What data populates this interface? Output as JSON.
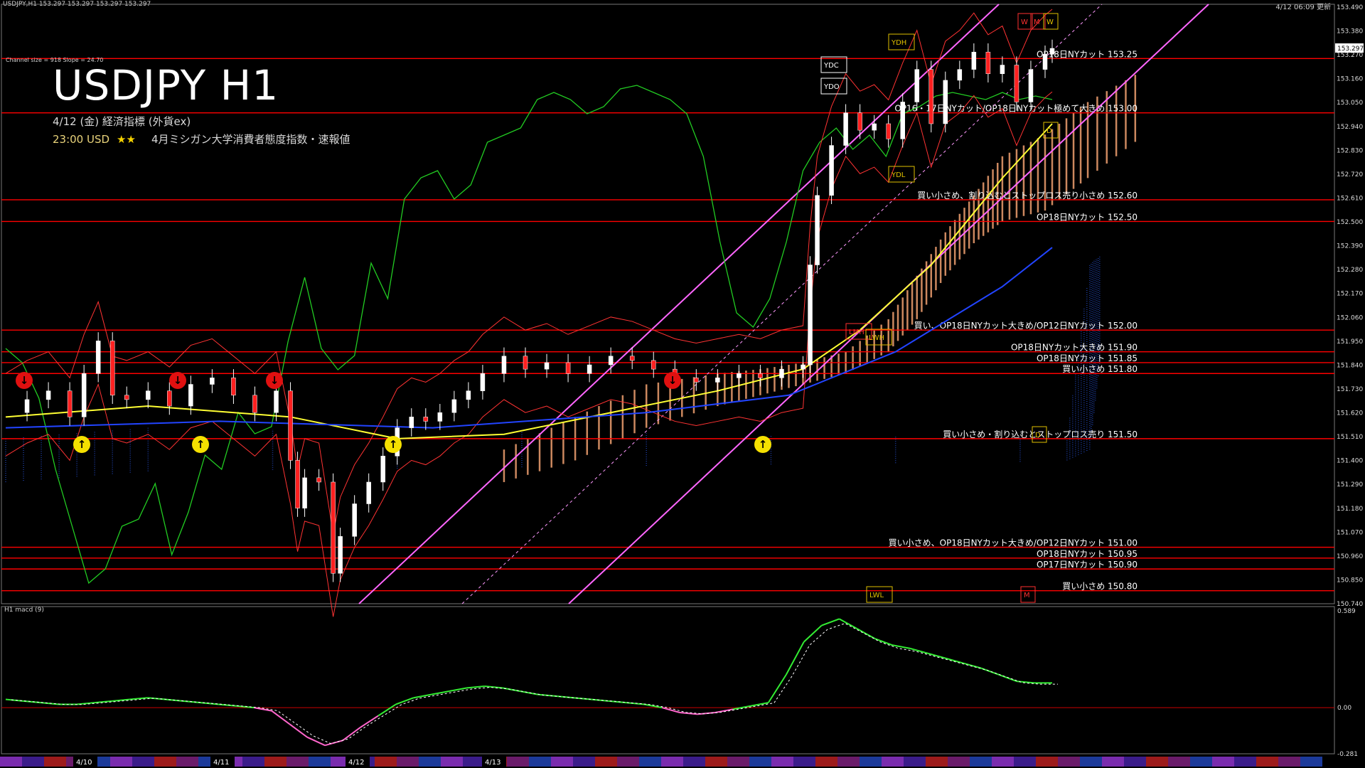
{
  "window": {
    "title": "USDJPY,H1  153.297 153.297 153.297 153.297",
    "timestamp": "4/12 06:09 更新"
  },
  "chart_title": "USDJPY H1",
  "channel_info": "Channel size = 918 Slope = 24.70",
  "event": {
    "heading": "4/12 (金) 経済指標 (外貨ex)",
    "time": "23:00 USD",
    "stars": "★★",
    "description": "4月ミシガン大学消費者態度指数・速報値"
  },
  "colors": {
    "background": "#000000",
    "level_line": "#ff0000",
    "channel": "#ff66ff",
    "ma_fast": "#ffff33",
    "ma_slow": "#2244ff",
    "bb": "#ff3333",
    "rsi": "#22cc22",
    "cloud": "#f0a070",
    "macd_pos": "#33ee33",
    "macd_neg": "#ff66cc"
  },
  "chart_data": [
    {
      "type": "line",
      "title": "USDJPY H1",
      "ylim": [
        150.74,
        153.5
      ],
      "y_ticks": [
        "153.490",
        "153.380",
        "153.270",
        "153.160",
        "153.050",
        "152.940",
        "152.830",
        "152.720",
        "152.610",
        "152.500",
        "152.390",
        "152.280",
        "152.170",
        "152.060",
        "151.950",
        "151.840",
        "151.730",
        "151.620",
        "151.510",
        "151.400",
        "151.290",
        "151.180",
        "151.070",
        "150.960",
        "150.850",
        "150.740"
      ],
      "current_price": "153.297",
      "date_labels": [
        "4/10",
        "4/11",
        "4/12",
        "4/13"
      ],
      "levels": [
        {
          "y": 153.25,
          "label": "OP18日NYカット 153.25"
        },
        {
          "y": 153.0,
          "label": "OP16・17日NYカット/OP18日NYカット極めて大きめ 153.00"
        },
        {
          "y": 152.6,
          "label": "買い小さめ、割り込むとストップロス売り小さめ 152.60"
        },
        {
          "y": 152.5,
          "label": "OP18日NYカット 152.50"
        },
        {
          "y": 152.0,
          "label": "買い、OP18日NYカット大きめ/OP12日NYカット 152.00"
        },
        {
          "y": 151.9,
          "label": "OP18日NYカット大きめ 151.90"
        },
        {
          "y": 151.85,
          "label": "OP18日NYカット 151.85"
        },
        {
          "y": 151.8,
          "label": "買い小さめ 151.80"
        },
        {
          "y": 151.5,
          "label": "買い小さめ・割り込むとストップロス売り 151.50"
        },
        {
          "y": 151.0,
          "label": "買い小さめ、OP18日NYカット大きめ/OP12日NYカット 151.00"
        },
        {
          "y": 150.95,
          "label": "OP18日NYカット 150.95"
        },
        {
          "y": 150.9,
          "label": "OP17日NYカット 150.90"
        },
        {
          "y": 150.8,
          "label": "買い小さめ 150.80"
        }
      ],
      "markers": [
        "YDH",
        "YDC",
        "YDO",
        "YDL",
        "LMH",
        "LWH",
        "LWL",
        "W",
        "M",
        "W",
        "D",
        "D",
        "M"
      ],
      "price_series": [
        {
          "t": 0,
          "v": 151.62
        },
        {
          "t": 3,
          "v": 151.68
        },
        {
          "t": 6,
          "v": 151.72
        },
        {
          "t": 9,
          "v": 151.6
        },
        {
          "t": 11,
          "v": 151.8
        },
        {
          "t": 13,
          "v": 151.95
        },
        {
          "t": 15,
          "v": 151.7
        },
        {
          "t": 17,
          "v": 151.68
        },
        {
          "t": 20,
          "v": 151.72
        },
        {
          "t": 23,
          "v": 151.65
        },
        {
          "t": 26,
          "v": 151.75
        },
        {
          "t": 29,
          "v": 151.78
        },
        {
          "t": 32,
          "v": 151.7
        },
        {
          "t": 35,
          "v": 151.62
        },
        {
          "t": 38,
          "v": 151.72
        },
        {
          "t": 40,
          "v": 151.4
        },
        {
          "t": 41,
          "v": 151.18
        },
        {
          "t": 42,
          "v": 151.32
        },
        {
          "t": 44,
          "v": 151.3
        },
        {
          "t": 46,
          "v": 150.88
        },
        {
          "t": 47,
          "v": 151.05
        },
        {
          "t": 49,
          "v": 151.2
        },
        {
          "t": 51,
          "v": 151.3
        },
        {
          "t": 53,
          "v": 151.42
        },
        {
          "t": 55,
          "v": 151.55
        },
        {
          "t": 57,
          "v": 151.6
        },
        {
          "t": 59,
          "v": 151.58
        },
        {
          "t": 61,
          "v": 151.62
        },
        {
          "t": 63,
          "v": 151.68
        },
        {
          "t": 65,
          "v": 151.72
        },
        {
          "t": 67,
          "v": 151.8
        },
        {
          "t": 70,
          "v": 151.88
        },
        {
          "t": 73,
          "v": 151.82
        },
        {
          "t": 76,
          "v": 151.85
        },
        {
          "t": 79,
          "v": 151.8
        },
        {
          "t": 82,
          "v": 151.84
        },
        {
          "t": 85,
          "v": 151.88
        },
        {
          "t": 88,
          "v": 151.86
        },
        {
          "t": 91,
          "v": 151.82
        },
        {
          "t": 94,
          "v": 151.78
        },
        {
          "t": 97,
          "v": 151.76
        },
        {
          "t": 100,
          "v": 151.78
        },
        {
          "t": 103,
          "v": 151.8
        },
        {
          "t": 106,
          "v": 151.78
        },
        {
          "t": 109,
          "v": 151.82
        },
        {
          "t": 112,
          "v": 151.84
        },
        {
          "t": 113,
          "v": 152.3
        },
        {
          "t": 114,
          "v": 152.62
        },
        {
          "t": 116,
          "v": 152.85
        },
        {
          "t": 118,
          "v": 153.0
        },
        {
          "t": 120,
          "v": 152.92
        },
        {
          "t": 122,
          "v": 152.95
        },
        {
          "t": 124,
          "v": 152.88
        },
        {
          "t": 126,
          "v": 153.05
        },
        {
          "t": 128,
          "v": 153.2
        },
        {
          "t": 130,
          "v": 152.95
        },
        {
          "t": 132,
          "v": 153.15
        },
        {
          "t": 134,
          "v": 153.2
        },
        {
          "t": 136,
          "v": 153.28
        },
        {
          "t": 138,
          "v": 153.18
        },
        {
          "t": 140,
          "v": 153.22
        },
        {
          "t": 142,
          "v": 153.05
        },
        {
          "t": 144,
          "v": 153.2
        },
        {
          "t": 146,
          "v": 153.27
        },
        {
          "t": 147,
          "v": 153.297
        }
      ]
    },
    {
      "type": "line",
      "title": "H1  macd (9)",
      "ylim": [
        -0.281,
        0.589
      ],
      "y_ticks": [
        "0.589",
        "0.00",
        "-0.281"
      ],
      "series": [
        {
          "values": [
            0.05,
            0.04,
            0.03,
            0.02,
            0.02,
            0.03,
            0.04,
            0.05,
            0.06,
            0.05,
            0.04,
            0.03,
            0.02,
            0.01,
            0.0,
            -0.02,
            -0.1,
            -0.18,
            -0.23,
            -0.2,
            -0.12,
            -0.05,
            0.02,
            0.06,
            0.08,
            0.1,
            0.12,
            0.13,
            0.12,
            0.1,
            0.08,
            0.07,
            0.06,
            0.05,
            0.04,
            0.03,
            0.02,
            0.0,
            -0.03,
            -0.04,
            -0.03,
            -0.01,
            0.01,
            0.03,
            0.2,
            0.4,
            0.5,
            0.54,
            0.48,
            0.42,
            0.38,
            0.36,
            0.33,
            0.3,
            0.27,
            0.24,
            0.2,
            0.16,
            0.15,
            0.15
          ]
        }
      ]
    }
  ]
}
